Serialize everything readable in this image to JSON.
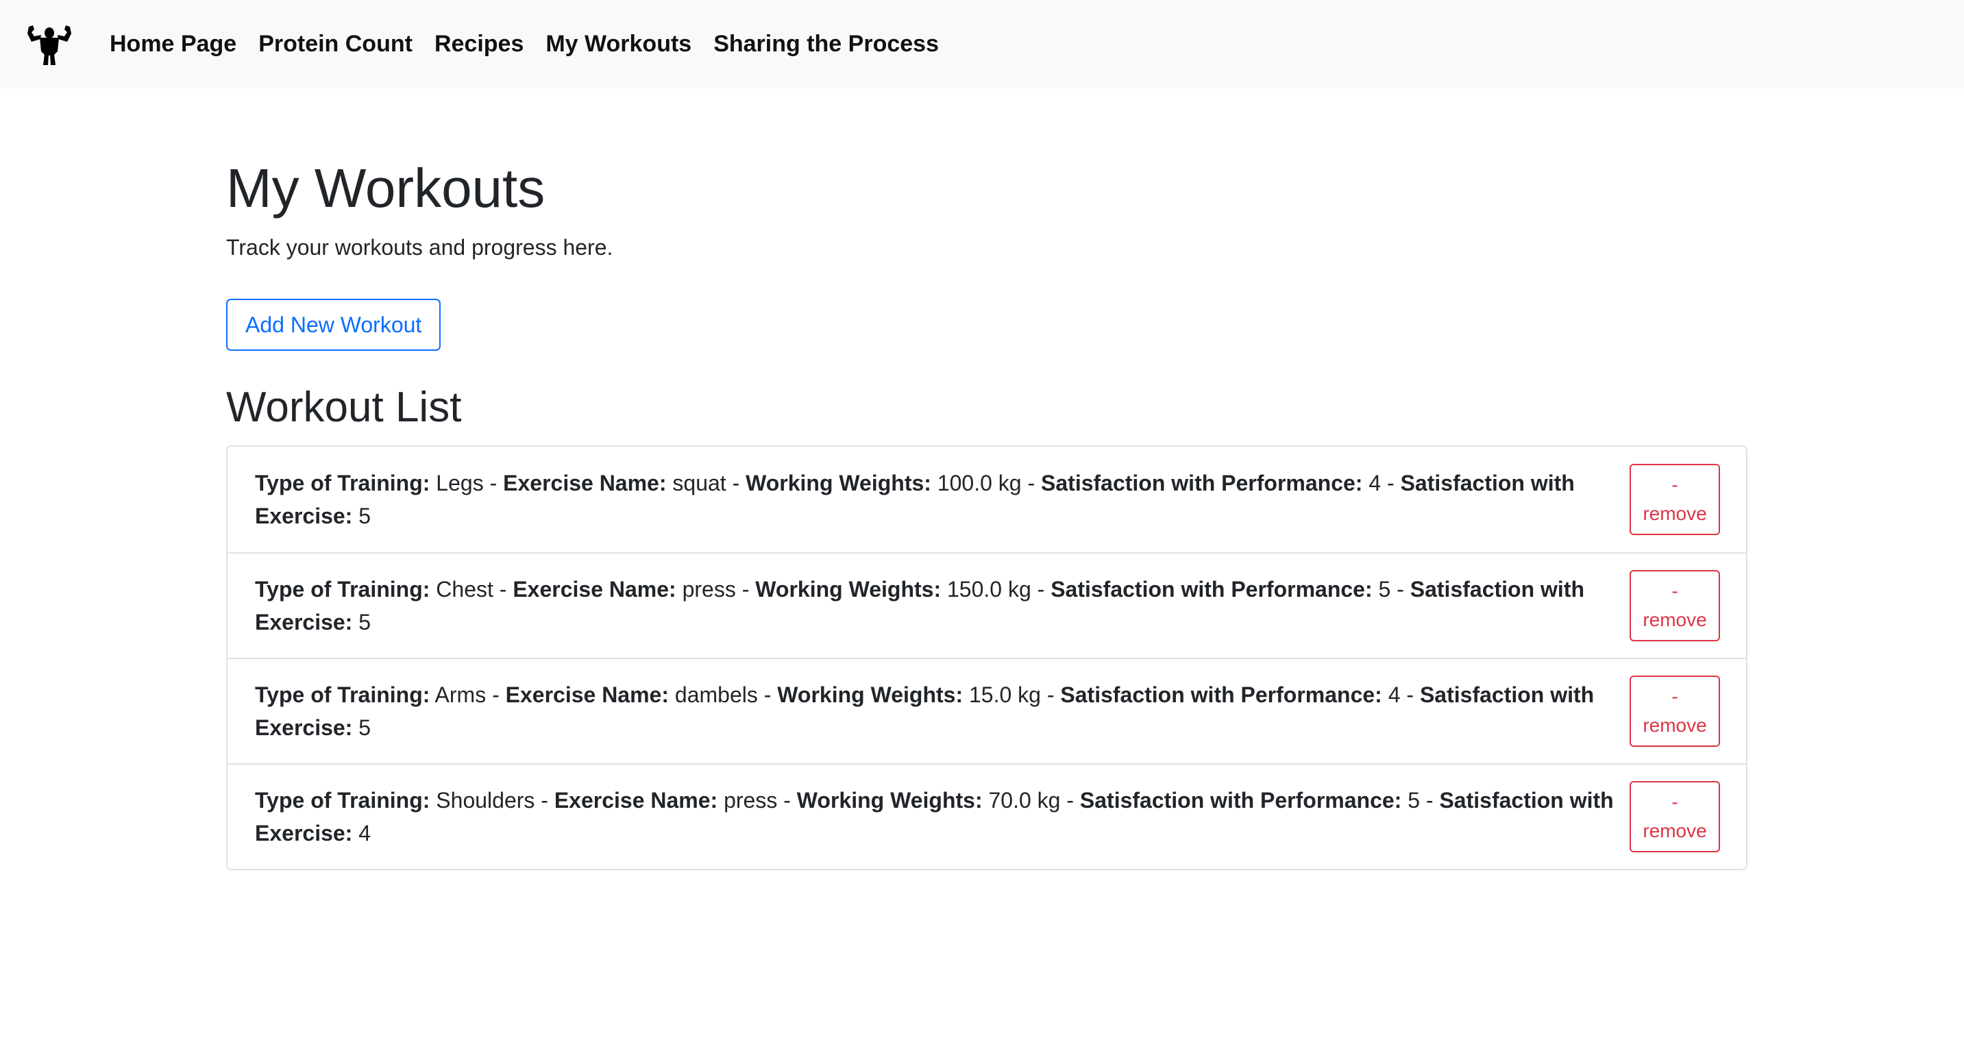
{
  "nav": {
    "logo_icon": "flexing-bodybuilder-icon",
    "links": [
      "Home Page",
      "Protein Count",
      "Recipes",
      "My Workouts",
      "Sharing the Process"
    ]
  },
  "main": {
    "title": "My Workouts",
    "subtitle": "Track your workouts and progress here.",
    "add_button": "Add New Workout",
    "list_title": "Workout List"
  },
  "labels": {
    "type": "Type of Training:",
    "exercise": "Exercise Name:",
    "weights": "Working Weights:",
    "perf": "Satisfaction with Performance:",
    "sat_ex": "Satisfaction with Exercise:",
    "sep": " - "
  },
  "workouts": [
    {
      "type": "Legs",
      "exercise": "squat",
      "weights": "100.0 kg",
      "perf": "4",
      "sat_ex": "5",
      "remove_dash": "-",
      "remove_label": "remove"
    },
    {
      "type": "Chest",
      "exercise": "press",
      "weights": "150.0 kg",
      "perf": "5",
      "sat_ex": "5",
      "remove_dash": "-",
      "remove_label": "remove"
    },
    {
      "type": "Arms",
      "exercise": "dambels",
      "weights": "15.0 kg",
      "perf": "4",
      "sat_ex": "5",
      "remove_dash": "-",
      "remove_label": "remove"
    },
    {
      "type": "Shoulders",
      "exercise": "press",
      "weights": "70.0 kg",
      "perf": "5",
      "sat_ex": "4",
      "remove_dash": "-",
      "remove_label": "remove"
    }
  ],
  "colors": {
    "navbar_bg": "#f8f9fa",
    "primary": "#0d6efd",
    "danger": "#dc3545",
    "border": "#dee2e6"
  }
}
